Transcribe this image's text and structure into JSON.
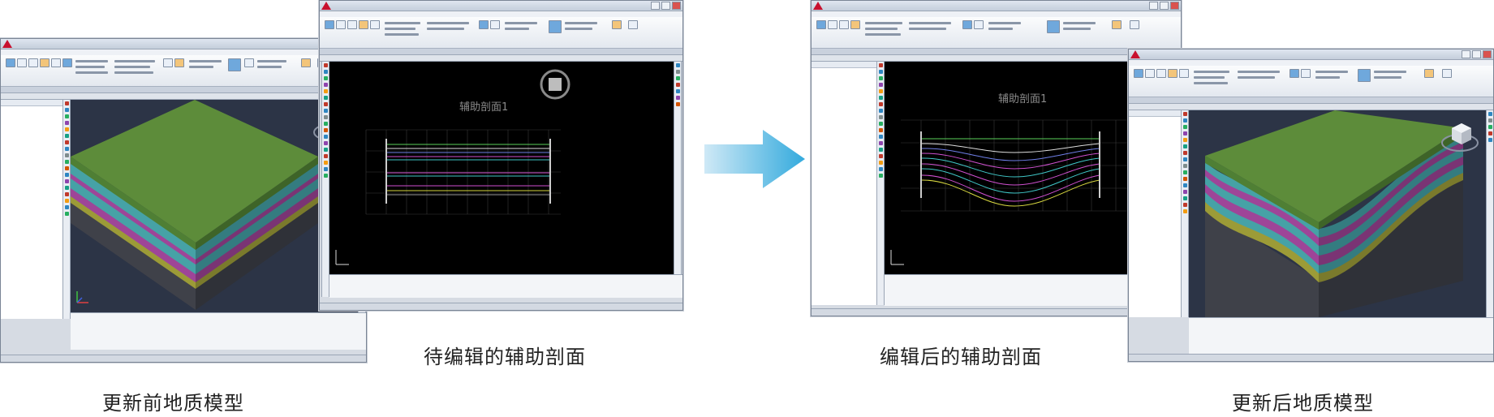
{
  "captions": {
    "before_model": "更新前地质模型",
    "section_to_edit": "待编辑的辅助剖面",
    "section_edited": "编辑后的辅助剖面",
    "after_model": "更新后地质模型"
  },
  "section_view": {
    "title": "辅助剖面1"
  },
  "colors": {
    "arrow": "#33aadd",
    "model_top": "#5d8c3a",
    "layer_cyan": "#47a5a8",
    "layer_magenta": "#a0469e",
    "layer_olive": "#a3a23e",
    "layer_base": "#4a4c55",
    "viewport_bg": "#2c3446",
    "section_bg": "#000000"
  },
  "icons": [
    "app-logo-icon",
    "view-cube-icon",
    "right-arrow-icon",
    "ucs-axis-icon"
  ]
}
